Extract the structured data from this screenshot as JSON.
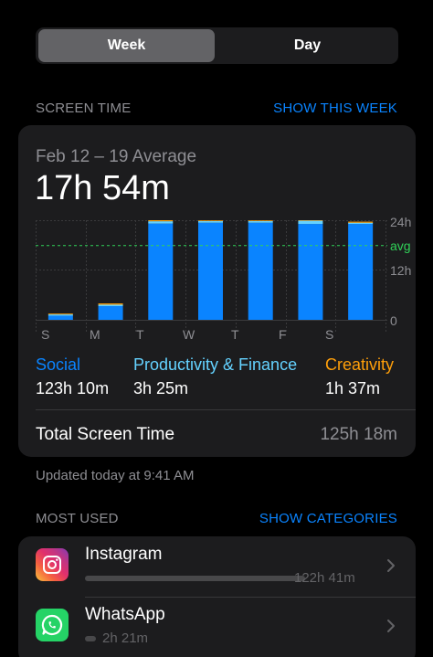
{
  "segmented": {
    "week_label": "Week",
    "day_label": "Day",
    "selected": "Week"
  },
  "screen_time": {
    "section_label": "SCREEN TIME",
    "show_link": "SHOW THIS WEEK",
    "range_label": "Feb 12 – 19 Average",
    "average": "17h 54m"
  },
  "chart_data": {
    "type": "bar",
    "categories": [
      "S",
      "M",
      "T",
      "W",
      "T",
      "F",
      "S"
    ],
    "y_tick_labels": [
      "24h",
      "avg",
      "12h",
      "0"
    ],
    "ylim": [
      0,
      24
    ],
    "average_hours": 17.9,
    "series": [
      {
        "name": "Social",
        "color": "#0a84ff",
        "values": [
          1.0,
          3.3,
          23.2,
          23.4,
          23.4,
          23.1,
          23.1
        ]
      },
      {
        "name": "Productivity & Finance",
        "color": "#64d2ff",
        "values": [
          0.3,
          0.35,
          0.55,
          0.4,
          0.45,
          0.8,
          0.3
        ]
      },
      {
        "name": "Creativity",
        "color": "#ff9f0a",
        "values": [
          0.2,
          0.3,
          0.4,
          0.15,
          0.1,
          0.15,
          0.25
        ]
      }
    ]
  },
  "categories": [
    {
      "name": "Social",
      "value": "123h 10m",
      "color": "#0a84ff"
    },
    {
      "name": "Productivity & Finance",
      "value": "3h 25m",
      "color": "#64d2ff"
    },
    {
      "name": "Creativity",
      "value": "1h 37m",
      "color": "#ff9f0a"
    }
  ],
  "total": {
    "label": "Total Screen Time",
    "value": "125h 18m"
  },
  "updated": "Updated today at 9:41 AM",
  "most_used": {
    "section_label": "MOST USED",
    "show_link": "SHOW CATEGORIES",
    "apps": [
      {
        "name": "Instagram",
        "usage": "122h 41m",
        "icon": "instagram-icon",
        "usage_fraction": 1.0
      },
      {
        "name": "WhatsApp",
        "usage": "2h 21m",
        "icon": "whatsapp-icon",
        "usage_fraction": 0.05
      }
    ]
  }
}
